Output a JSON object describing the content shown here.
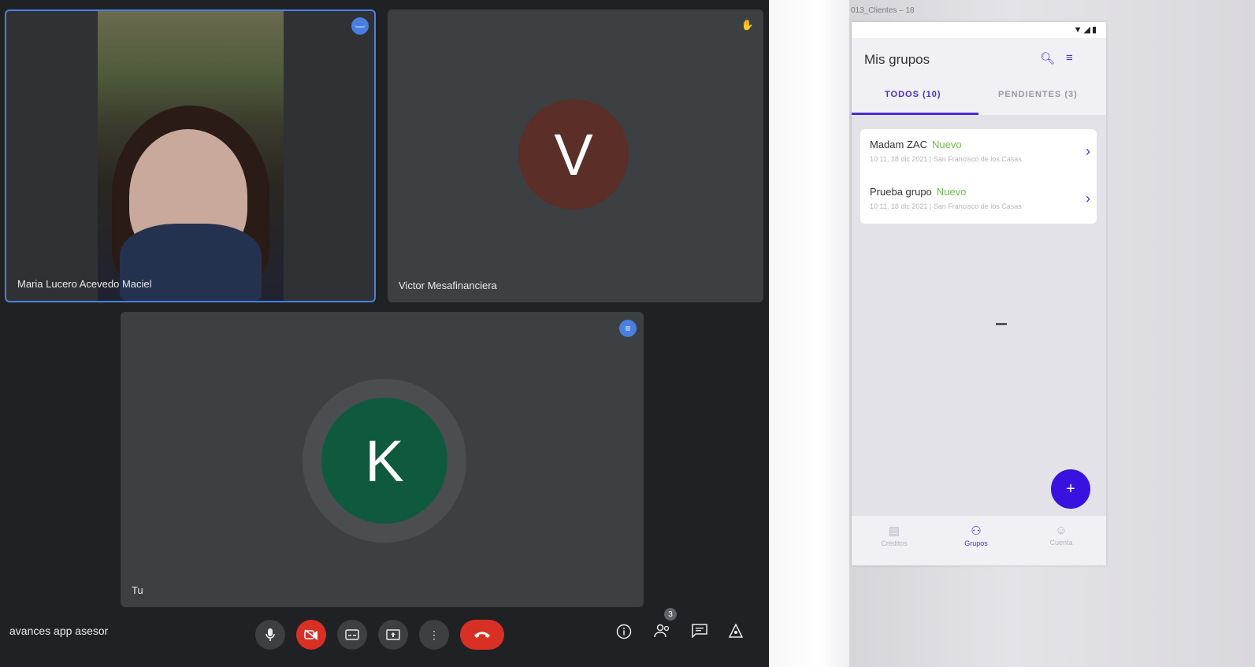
{
  "meet": {
    "participants": [
      {
        "name": "Maria Lucero Acevedo Maciel"
      },
      {
        "name": "Victor Mesafinanciera",
        "initial": "V",
        "color": "#5b2e27"
      },
      {
        "name": "Tu",
        "initial": "K",
        "color": "#0f5a3f"
      }
    ],
    "meeting_name": "avances app asesor",
    "participants_count": "3",
    "icons": {
      "mic": "mic-icon",
      "camera_off": "camera-off-icon",
      "captions": "captions-icon",
      "present": "present-icon",
      "more": "more-vert-icon",
      "leave": "call-end-icon",
      "info": "info-icon",
      "people": "people-icon",
      "chat": "chat-icon",
      "activities": "activities-icon"
    }
  },
  "emulator": {
    "window_title": "013_Clientes – 18",
    "app": {
      "title": "Mis grupos",
      "tabs": [
        {
          "label": "TODOS (10)",
          "active": true
        },
        {
          "label": "PENDIENTES (3)",
          "active": false
        }
      ],
      "groups": [
        {
          "name": "Madam ZAC",
          "status": "Nuevo",
          "subtitle": "10:11, 18 dic 2021 | San Francisco de los Casas"
        },
        {
          "name": "Prueba grupo",
          "status": "Nuevo",
          "subtitle": "10:11, 18 dic 2021 | San Francisco de los Casas"
        }
      ],
      "fab_label": "+",
      "bottom_nav": [
        {
          "label": "Créditos",
          "icon": "credits-icon",
          "active": false
        },
        {
          "label": "Grupos",
          "icon": "groups-icon",
          "active": true
        },
        {
          "label": "Cuenta",
          "icon": "account-icon",
          "active": false
        }
      ],
      "accent_color": "#4b2bd6",
      "status_color": "#6cc04a"
    }
  }
}
